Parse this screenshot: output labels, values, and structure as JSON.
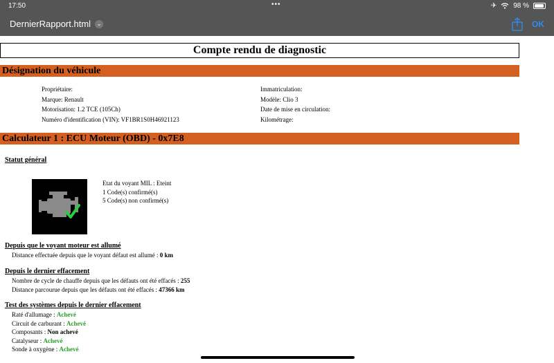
{
  "status_bar": {
    "time": "17:50",
    "battery": "98 %"
  },
  "nav": {
    "title": "DernierRapport.html",
    "ok_label": "OK"
  },
  "report": {
    "title": "Compte rendu de diagnostic",
    "vehicle": {
      "header": "Désignation du véhicule",
      "left": [
        "Propriétaire:",
        "Marque: Renault",
        "Motorisation: 1.2 TCE (105Ch)",
        "Numéro d'identification (VIN): VF1BR1S0H46921123"
      ],
      "right": [
        "Immatriculation:",
        "Modèle: Clio 3",
        "Date de mise en circulation:",
        "Kilométrage:"
      ]
    },
    "ecu": {
      "header": "Calculateur 1 : ECU Moteur (OBD) - 0x7E8",
      "general_status_label": "Statut général",
      "mil_lines": [
        "Etat du voyant MIL : Eteint",
        "1 Code(s) confirmé(s)",
        "5 Code(s) non confirmé(s)"
      ],
      "since_mil": {
        "heading": "Depuis que le voyant moteur est allumé",
        "label": "Distance effectuée depuis que le voyant défaut est allumé : ",
        "value": "0 km"
      },
      "since_clear": {
        "heading": "Depuis le dernier effacement",
        "rows": [
          {
            "label": "Nombre de cycle de chauffe depuis que les défauts ont été effacés : ",
            "value": "255"
          },
          {
            "label": "Distance parcourue depuis que les défauts ont été effacés : ",
            "value": "47366 km"
          }
        ]
      },
      "tests": {
        "heading": "Test des systèmes depuis le dernier effacement",
        "rows": [
          {
            "label": "Raté d'allumage : ",
            "value": "Achevé"
          },
          {
            "label": "Circuit de carburant : ",
            "value": "Achevé"
          },
          {
            "label": "Composants : ",
            "value": "Non achevé"
          },
          {
            "label": "Catalyseur : ",
            "value": "Achevé"
          },
          {
            "label": "Sonde à oxygène : ",
            "value": "Achevé"
          }
        ]
      }
    }
  }
}
